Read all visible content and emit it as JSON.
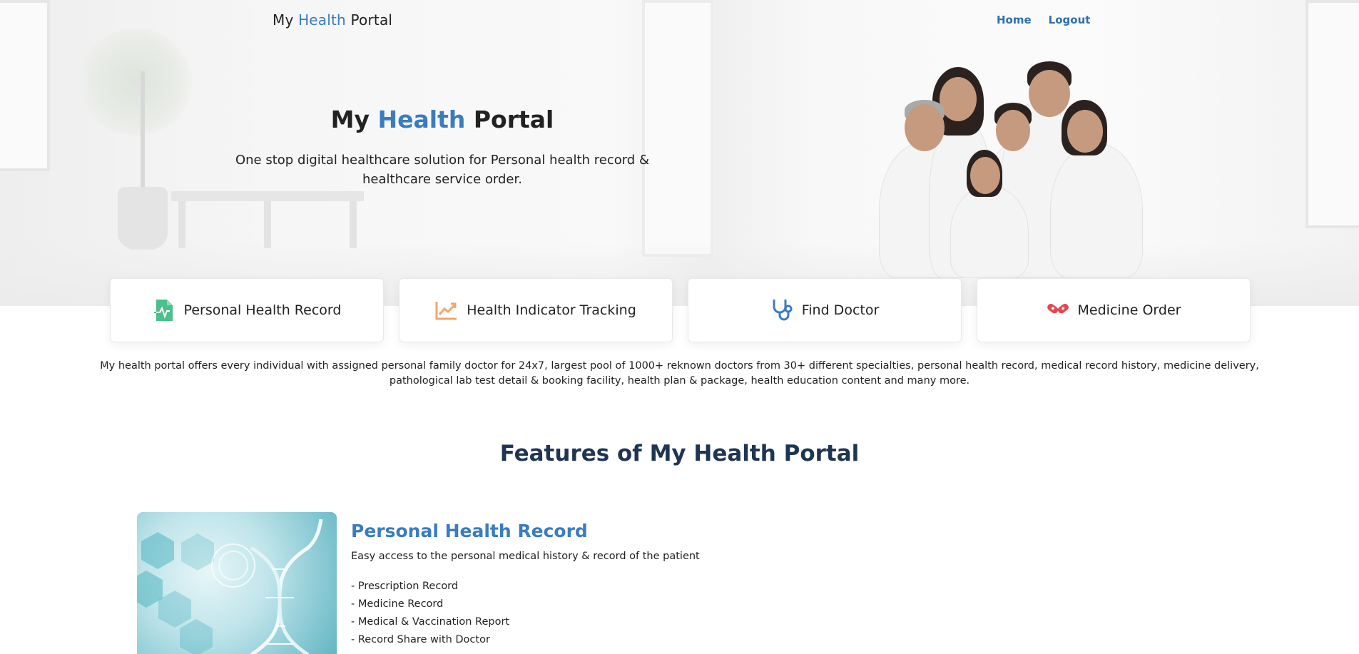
{
  "nav": {
    "brand_prefix": "My ",
    "brand_accent": "Health",
    "brand_suffix": " Portal",
    "links": [
      {
        "label": "Home"
      },
      {
        "label": "Logout"
      }
    ]
  },
  "hero": {
    "title_prefix": "My ",
    "title_accent": "Health",
    "title_suffix": " Portal",
    "subtitle": "One stop digital healthcare solution for Personal health record & healthcare service order."
  },
  "services": [
    {
      "label": "Personal Health Record",
      "icon": "document-pulse-icon",
      "color": "#4cbf8c"
    },
    {
      "label": "Health Indicator Tracking",
      "icon": "trend-chart-icon",
      "color": "#f3a46a"
    },
    {
      "label": "Find Doctor",
      "icon": "stethoscope-icon",
      "color": "#3a7cc0"
    },
    {
      "label": "Medicine Order",
      "icon": "capsule-icon",
      "color": "#e2474f"
    }
  ],
  "description": "My health portal offers every individual with assigned personal family doctor for 24x7, largest pool of 1000+ reknown doctors from 30+ different specialties, personal health record, medical record history, medicine delivery, pathological lab test detail & booking facility, health plan & package, health education content and many more.",
  "features": {
    "heading": "Features of My Health Portal",
    "items": [
      {
        "title": "Personal Health Record",
        "subtitle": "Easy access to the personal medical history & record of the patient",
        "bullets": [
          "- Prescription Record",
          "- Medicine Record",
          "- Medical & Vaccination Report",
          "- Record Share with Doctor"
        ]
      }
    ]
  },
  "colors": {
    "accent": "#3a7cc0",
    "heading_dark": "#1e3554",
    "text": "#222222"
  }
}
